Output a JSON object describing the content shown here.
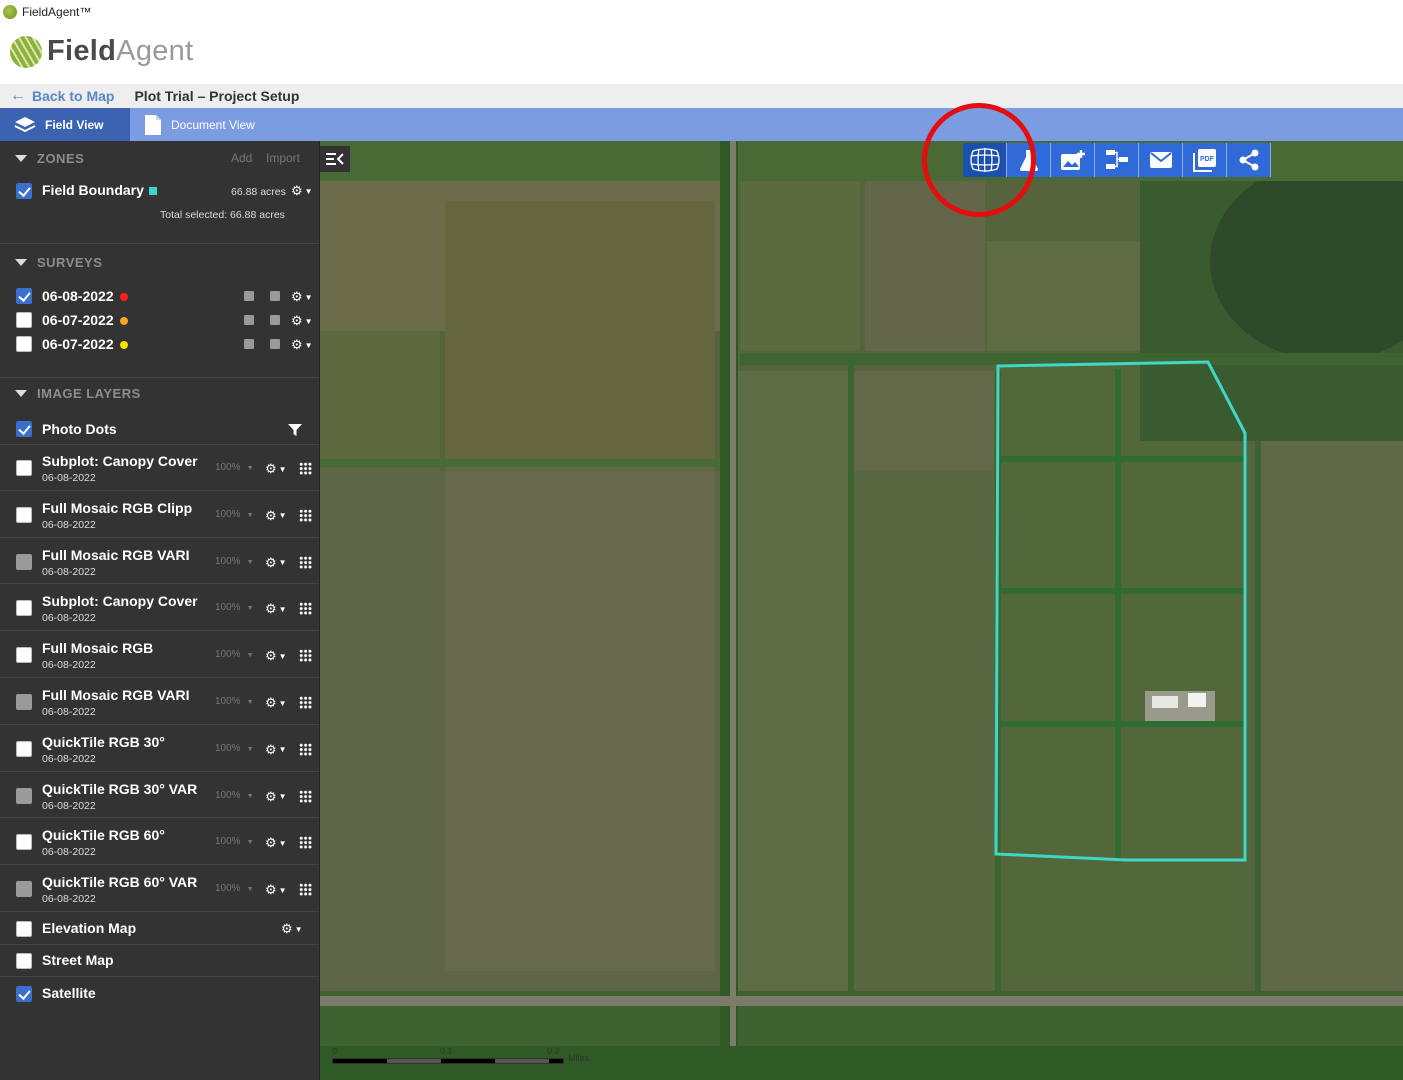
{
  "window": {
    "title": "FieldAgent™"
  },
  "logo": {
    "field": "Field",
    "agent": "Agent"
  },
  "breadcrumb": {
    "back": "Back to Map",
    "title": "Plot Trial – Project Setup"
  },
  "tabs": [
    {
      "label": "Field View"
    },
    {
      "label": "Document View"
    }
  ],
  "zones": {
    "header": "ZONES",
    "add": "Add",
    "import": "Import",
    "items": [
      {
        "label": "Field Boundary",
        "acres": "66.88 acres",
        "color": "#3fd8c8",
        "checked": true
      }
    ],
    "total": "Total selected: 66.88 acres"
  },
  "surveys": {
    "header": "SURVEYS",
    "items": [
      {
        "label": "06-08-2022",
        "color": "#ff1f1f",
        "checked": true
      },
      {
        "label": "06-07-2022",
        "color": "#f5a623",
        "checked": false
      },
      {
        "label": "06-07-2022",
        "color": "#f5e000",
        "checked": false
      }
    ]
  },
  "image_layers": {
    "header": "IMAGE LAYERS",
    "photo_dots": {
      "label": "Photo Dots",
      "checked": true
    },
    "items": [
      {
        "label": "Subplot: Canopy Cover",
        "date": "06-08-2022",
        "opacity": "100%",
        "state": "unchecked"
      },
      {
        "label": "Full Mosaic RGB Clipp",
        "date": "06-08-2022",
        "opacity": "100%",
        "state": "unchecked"
      },
      {
        "label": "Full Mosaic RGB  VARI",
        "date": "06-08-2022",
        "opacity": "100%",
        "state": "disabled"
      },
      {
        "label": "Subplot: Canopy Cover",
        "date": "06-08-2022",
        "opacity": "100%",
        "state": "unchecked"
      },
      {
        "label": "Full Mosaic RGB",
        "date": "06-08-2022",
        "opacity": "100%",
        "state": "unchecked"
      },
      {
        "label": "Full Mosaic RGB VARI",
        "date": "06-08-2022",
        "opacity": "100%",
        "state": "disabled"
      },
      {
        "label": "QuickTile RGB 30°",
        "date": "06-08-2022",
        "opacity": "100%",
        "state": "unchecked"
      },
      {
        "label": "QuickTile RGB 30° VAR",
        "date": "06-08-2022",
        "opacity": "100%",
        "state": "disabled"
      },
      {
        "label": "QuickTile RGB 60°",
        "date": "06-08-2022",
        "opacity": "100%",
        "state": "unchecked"
      },
      {
        "label": "QuickTile RGB 60° VAR",
        "date": "06-08-2022",
        "opacity": "100%",
        "state": "disabled"
      }
    ],
    "base": [
      {
        "label": "Elevation Map",
        "checked": false
      },
      {
        "label": "Street Map",
        "checked": false
      },
      {
        "label": "Satellite",
        "checked": true
      }
    ]
  },
  "toolbar": {
    "buttons": [
      "plot-grid-icon",
      "flask-icon",
      "add-image-icon",
      "layout-icon",
      "email-icon",
      "pdf-icon",
      "share-icon"
    ],
    "pdf_text": "PDF"
  },
  "map": {
    "boundary_color": "#3fd8c8",
    "scale": {
      "labels": [
        "0",
        "0.1",
        "0.2"
      ],
      "unit": "Miles"
    }
  },
  "highlight": {
    "color": "#e50d0d"
  }
}
